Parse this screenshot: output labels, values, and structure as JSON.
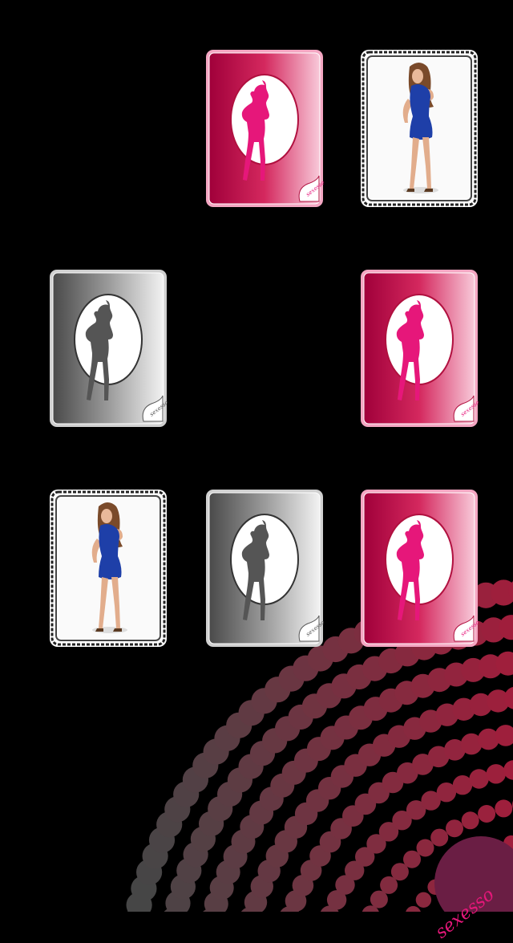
{
  "brand": {
    "text": "sexesso"
  },
  "card_logo_text": "sexesso",
  "colors": {
    "background": "#000000",
    "pink_dark": "#a0003a",
    "pink_mid": "#d4285e",
    "pink_light": "#f8c9d9",
    "silhouette_pink": "#e6177a",
    "gray_dark": "#4a4a4a",
    "gray_light": "#f2f2f2",
    "silhouette_gray": "#555555",
    "dress_blue": "#1e3fa8"
  },
  "board": {
    "rows": [
      [
        {
          "state": "empty"
        },
        {
          "state": "face-down",
          "back": "pink"
        },
        {
          "state": "face-up",
          "image": "woman-blue-dress"
        }
      ],
      [
        {
          "state": "face-down",
          "back": "gray"
        },
        {
          "state": "empty"
        },
        {
          "state": "face-down",
          "back": "pink"
        }
      ],
      [
        {
          "state": "face-up",
          "image": "woman-blue-dress"
        },
        {
          "state": "face-down",
          "back": "gray"
        },
        {
          "state": "face-down",
          "back": "pink"
        }
      ]
    ]
  }
}
